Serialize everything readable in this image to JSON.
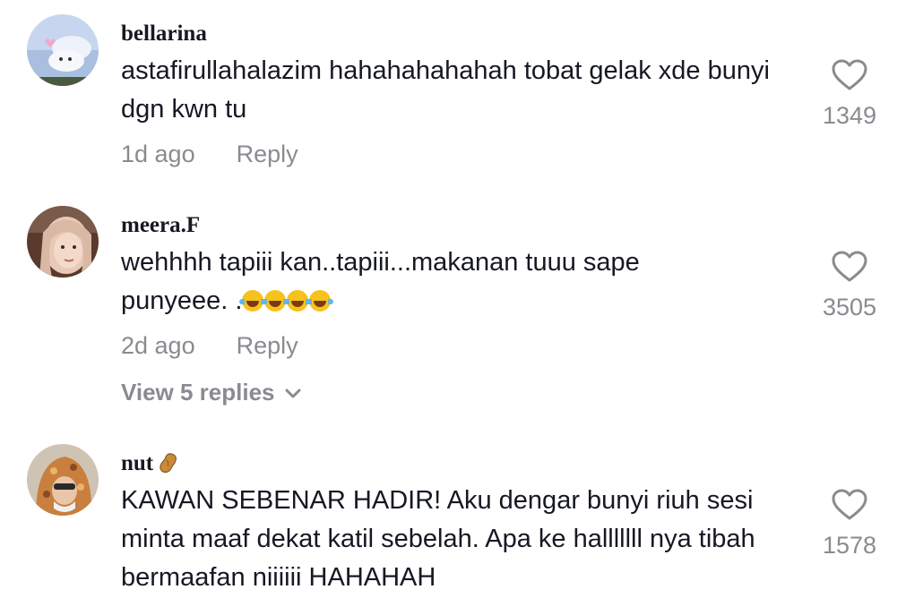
{
  "comments": [
    {
      "username": "bellarina",
      "text": "astafirullahalazim hahahahahahah tobat gelak xde bunyi dgn kwn tu",
      "time": "1d ago",
      "reply_label": "Reply",
      "likes": "1349"
    },
    {
      "username": "meera.F",
      "text": "wehhhh tapiii kan..tapiii...makanan tuuu sape punyeee. .",
      "time": "2d ago",
      "reply_label": "Reply",
      "likes": "3505",
      "view_replies": "View 5 replies"
    },
    {
      "username": "nut",
      "text": "KAWAN SEBENAR HADIR! Aku dengar bunyi riuh sesi minta maaf dekat katil sebelah. Apa ke halllllll nya tibah bermaafan niiiiii HAHAHAH",
      "likes": "1578"
    }
  ],
  "icons": {
    "like": "heart-outline-icon",
    "expand": "chevron-down-icon",
    "emoji": "tears-of-joy-emoji",
    "username_badge": "peanut-emoji"
  },
  "colors": {
    "text_primary": "#161823",
    "text_secondary": "#8a8b91"
  }
}
